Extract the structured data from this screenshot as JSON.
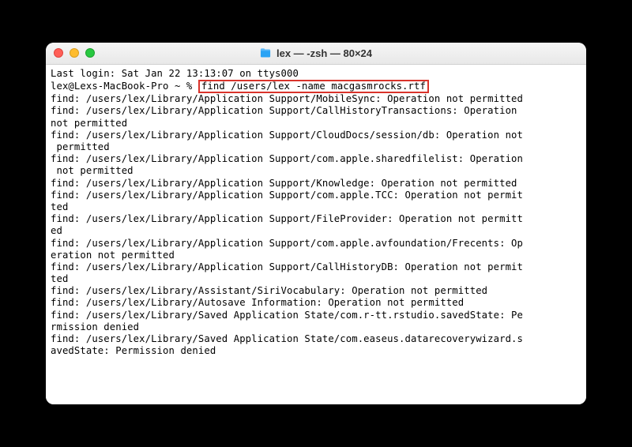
{
  "window": {
    "title": "lex — -zsh — 80×24",
    "icon": "folder-home-icon",
    "traffic": {
      "close": "#ff5f57",
      "minimize": "#febc2e",
      "zoom": "#28c840"
    }
  },
  "session": {
    "last_login": "Last login: Sat Jan 22 13:13:07 on ttys000",
    "prompt": "lex@Lexs-MacBook-Pro ~ % ",
    "command": "find /users/lex -name macgasmrocks.rtf",
    "output": [
      "find: /users/lex/Library/Application Support/MobileSync: Operation not permitted",
      "find: /users/lex/Library/Application Support/CallHistoryTransactions: Operation not permitted",
      "find: /users/lex/Library/Application Support/CloudDocs/session/db: Operation not permitted",
      "find: /users/lex/Library/Application Support/com.apple.sharedfilelist: Operation not permitted",
      "find: /users/lex/Library/Application Support/Knowledge: Operation not permitted",
      "find: /users/lex/Library/Application Support/com.apple.TCC: Operation not permitted",
      "find: /users/lex/Library/Application Support/FileProvider: Operation not permitted",
      "find: /users/lex/Library/Application Support/com.apple.avfoundation/Frecents: Operation not permitted",
      "find: /users/lex/Library/Application Support/CallHistoryDB: Operation not permitted",
      "find: /users/lex/Library/Assistant/SiriVocabulary: Operation not permitted",
      "find: /users/lex/Library/Autosave Information: Operation not permitted",
      "find: /users/lex/Library/Saved Application State/com.r-tt.rstudio.savedState: Permission denied",
      "find: /users/lex/Library/Saved Application State/com.easeus.datarecoverywizard.savedState: Permission denied"
    ]
  }
}
